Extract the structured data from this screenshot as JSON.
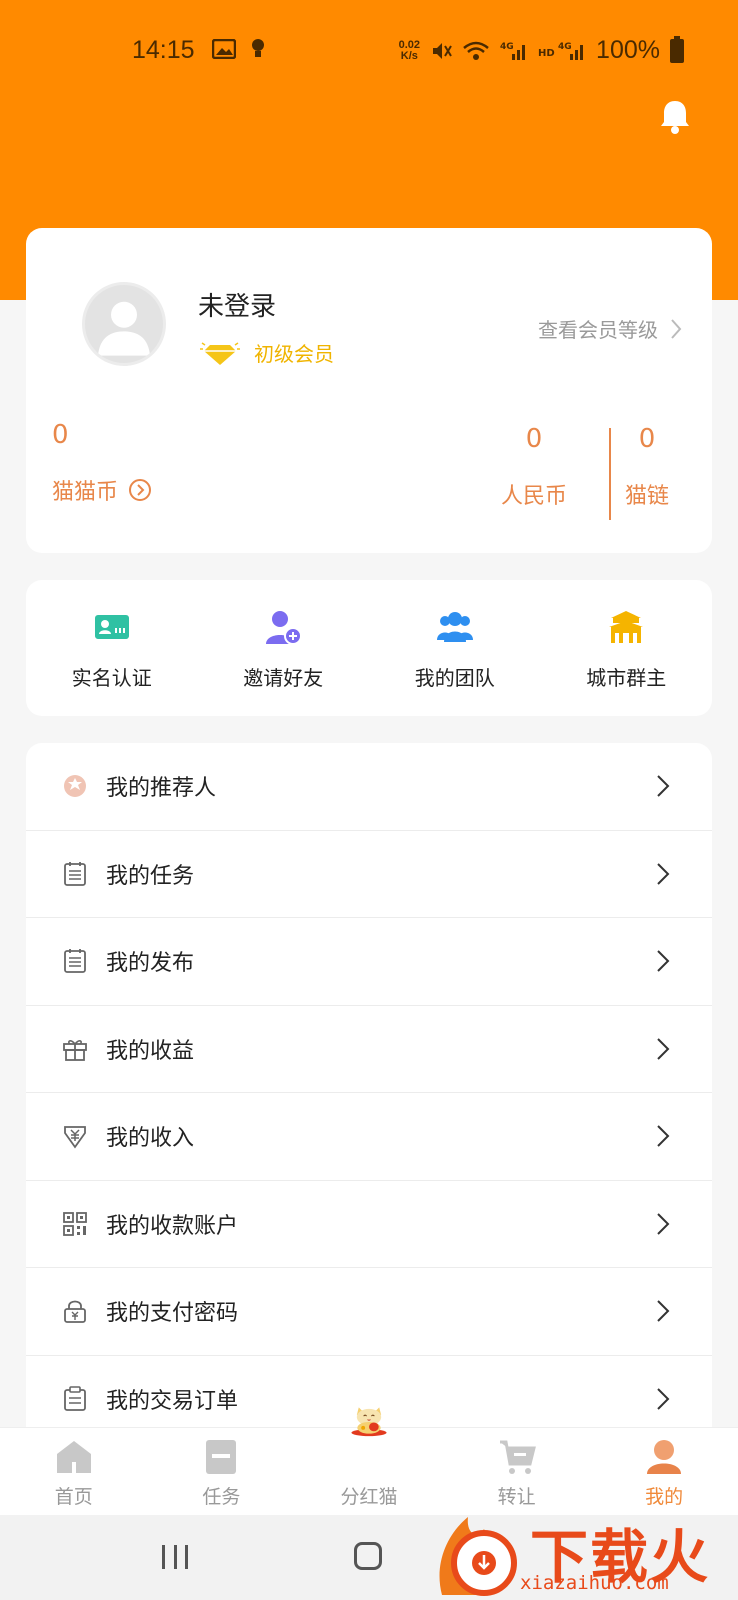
{
  "status_bar": {
    "time": "14:15",
    "speed_top": "0.02",
    "speed_bottom": "K/s",
    "battery": "100%"
  },
  "profile": {
    "username": "未登录",
    "member_level": "初级会员",
    "view_level": "查看会员等级"
  },
  "stats": {
    "coins_value": "0",
    "coins_label": "猫猫币",
    "rmb_value": "0",
    "rmb_label": "人民币",
    "chain_value": "0",
    "chain_label": "猫链"
  },
  "quick_actions": [
    {
      "label": "实名认证",
      "icon": "id-card-icon"
    },
    {
      "label": "邀请好友",
      "icon": "add-user-icon"
    },
    {
      "label": "我的团队",
      "icon": "team-icon"
    },
    {
      "label": "城市群主",
      "icon": "city-gate-icon"
    }
  ],
  "menu": [
    {
      "label": "我的推荐人",
      "icon": "referrer-icon"
    },
    {
      "label": "我的任务",
      "icon": "task-list-icon"
    },
    {
      "label": "我的发布",
      "icon": "publish-list-icon"
    },
    {
      "label": "我的收益",
      "icon": "gift-icon"
    },
    {
      "label": "我的收入",
      "icon": "yuan-shield-icon"
    },
    {
      "label": "我的收款账户",
      "icon": "qr-code-icon"
    },
    {
      "label": "我的支付密码",
      "icon": "lock-icon"
    },
    {
      "label": "我的交易订单",
      "icon": "clipboard-icon"
    }
  ],
  "tabs": [
    {
      "label": "首页",
      "icon": "home-icon"
    },
    {
      "label": "任务",
      "icon": "task-icon"
    },
    {
      "label": "分红猫",
      "icon": "lucky-cat-icon"
    },
    {
      "label": "转让",
      "icon": "cart-icon"
    },
    {
      "label": "我的",
      "icon": "profile-icon"
    }
  ],
  "watermark": {
    "title": "下载火",
    "url": "xiazaihuo.com"
  },
  "colors": {
    "brand_orange": "#ff8a00",
    "stat_orange": "#e8874a",
    "gold": "#f0b400"
  }
}
